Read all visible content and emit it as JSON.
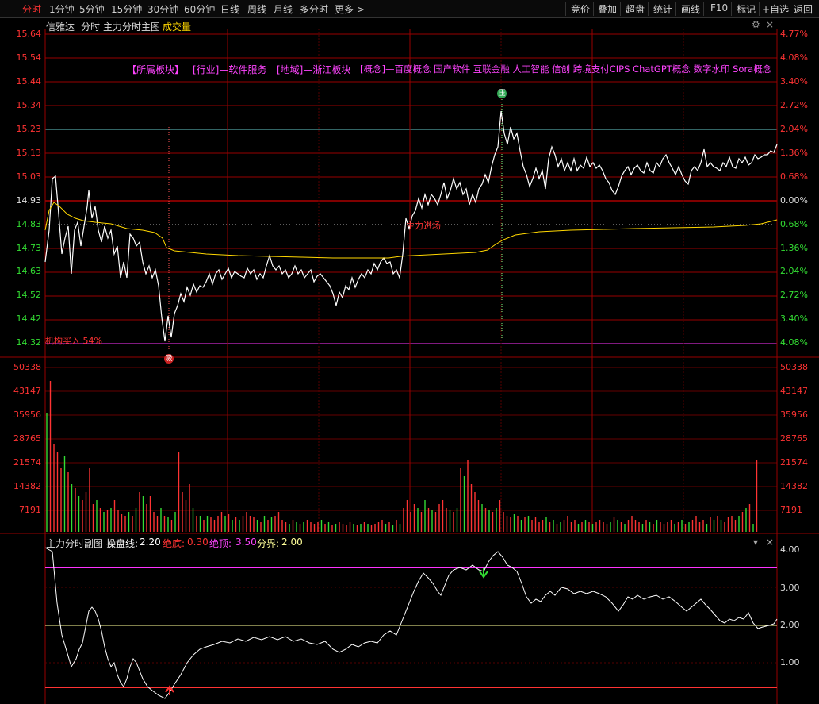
{
  "toolbar": {
    "left_tabs": [
      "分时",
      "1分钟",
      "5分钟",
      "15分钟",
      "30分钟",
      "60分钟",
      "日线",
      "周线",
      "月线",
      "多分时",
      "更多 >"
    ],
    "right_buttons": [
      "竞价",
      "叠加",
      "超盘",
      "统计",
      "画线",
      "F10",
      "标记",
      "+自选",
      "返回"
    ]
  },
  "main_header": {
    "stock_name": "信雅达",
    "mode": "分时",
    "indicator": "主力分时主图",
    "volume_label": "成交量"
  },
  "sectors": [
    "【所属板块】",
    "[行业]—软件服务",
    "[地域]—浙江板块",
    "[概念]—百度概念 国产软件 互联金融 人工智能 信创 跨境支付CIPS ChatGPT概念 数字水印 Sora概念"
  ],
  "price_axis": [
    "15.64",
    "15.54",
    "15.44",
    "15.34",
    "15.23",
    "15.13",
    "15.03",
    "14.93",
    "14.83",
    "14.73",
    "14.63",
    "14.52",
    "14.42",
    "14.32"
  ],
  "percent_axis": [
    "4.77%",
    "4.08%",
    "3.40%",
    "2.72%",
    "2.04%",
    "1.36%",
    "0.68%",
    "0.00%",
    "0.68%",
    "1.36%",
    "2.04%",
    "2.72%",
    "3.40%",
    "4.08%"
  ],
  "volume_axis": [
    "50338",
    "43147",
    "35956",
    "28765",
    "21574",
    "14382",
    "7191"
  ],
  "annotations": {
    "institution": "机构买入 54%",
    "main_force": "主力进场",
    "top_marker": "压",
    "bottom_marker": "吸"
  },
  "sub_panel": {
    "title": "主力分时副图",
    "items": [
      {
        "label": "操盘线:",
        "value": "2.20",
        "color": "#ffffff"
      },
      {
        "label": "绝底:",
        "value": "0.30",
        "color": "#ff3333"
      },
      {
        "label": "绝顶:",
        "value": "3.50",
        "color": "#ff44ff"
      },
      {
        "label": "分界:",
        "value": "2.00",
        "color": "#ffff99"
      }
    ],
    "axis": [
      "4.00",
      "3.00",
      "2.00",
      "1.00"
    ],
    "controls": [
      "▾",
      "×"
    ]
  },
  "colors": {
    "up": "#ff3333",
    "down": "#33dd33",
    "avg_line": "#ffd700",
    "price_line": "#ffffff",
    "band_top": "#ff33ff",
    "band_bottom": "#ff3333",
    "divider": "#ffff99",
    "accent_sector": "#ff44ff"
  }
}
